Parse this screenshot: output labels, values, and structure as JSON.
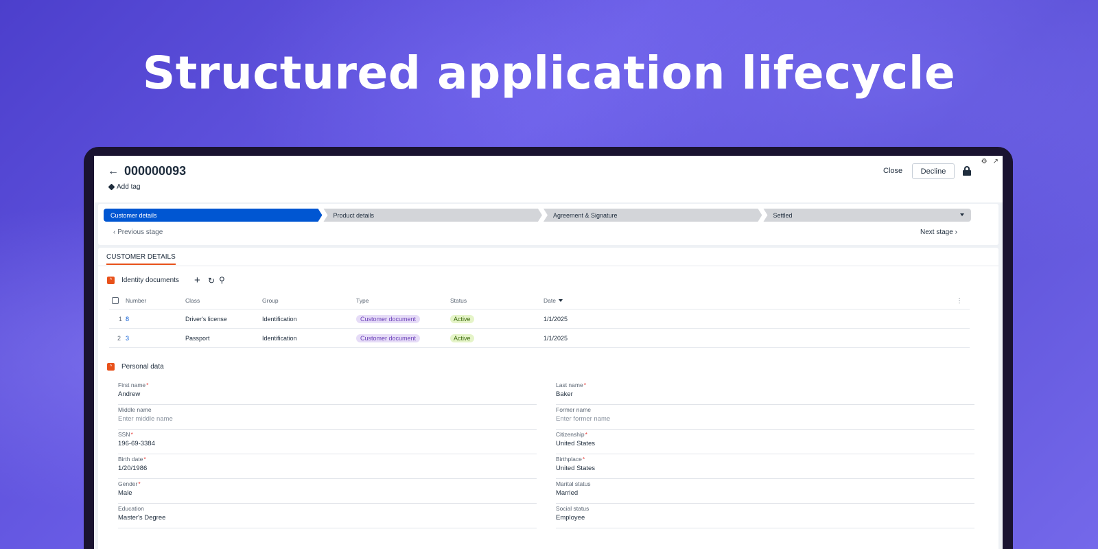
{
  "hero": {
    "title": "Structured application lifecycle"
  },
  "header": {
    "record_number": "000000093",
    "add_tag": "Add tag",
    "close_label": "Close",
    "decline_label": "Decline",
    "corner_icons": [
      "settings-icon",
      "expand-icon"
    ]
  },
  "stages": {
    "items": [
      {
        "label": "Customer details",
        "active": true
      },
      {
        "label": "Product details",
        "active": false
      },
      {
        "label": "Agreement & Signature",
        "active": false
      },
      {
        "label": "Settled",
        "active": false
      }
    ],
    "prev_label": "Previous stage",
    "next_label": "Next stage",
    "active_color": "#0056d2"
  },
  "section": {
    "tab_label": "CUSTOMER DETAILS",
    "accent_color": "#e8511a"
  },
  "identity_documents": {
    "title": "Identity documents",
    "columns": [
      "Number",
      "Class",
      "Group",
      "Type",
      "Status",
      "Date"
    ],
    "rows": [
      {
        "index": "1",
        "number": "8",
        "class": "Driver's license",
        "group": "Identification",
        "type": "Customer document",
        "status": "Active",
        "date": "1/1/2025"
      },
      {
        "index": "2",
        "number": "3",
        "class": "Passport",
        "group": "Identification",
        "type": "Customer document",
        "status": "Active",
        "date": "1/1/2025"
      }
    ]
  },
  "personal_data": {
    "title": "Personal data",
    "left": [
      {
        "label": "First name",
        "required": "*",
        "value": "Andrew",
        "placeholder": ""
      },
      {
        "label": "Middle name",
        "required": "",
        "value": "",
        "placeholder": "Enter middle name"
      },
      {
        "label": "SSN",
        "required": "*",
        "value": "196-69-3384",
        "placeholder": ""
      },
      {
        "label": "Birth date",
        "required": "*",
        "value": "1/20/1986",
        "placeholder": ""
      },
      {
        "label": "Gender",
        "required": "*",
        "value": "Male",
        "placeholder": ""
      },
      {
        "label": "Education",
        "required": "",
        "value": "Master's Degree",
        "placeholder": ""
      }
    ],
    "right": [
      {
        "label": "Last name",
        "required": "*",
        "value": "Baker",
        "placeholder": ""
      },
      {
        "label": "Former name",
        "required": "",
        "value": "",
        "placeholder": "Enter former name"
      },
      {
        "label": "Citizenship",
        "required": "*",
        "value": "United States",
        "placeholder": ""
      },
      {
        "label": "Birthplace",
        "required": "*",
        "value": "United States",
        "placeholder": ""
      },
      {
        "label": "Marital status",
        "required": "",
        "value": "Married",
        "placeholder": ""
      },
      {
        "label": "Social status",
        "required": "",
        "value": "Employee",
        "placeholder": ""
      }
    ]
  }
}
